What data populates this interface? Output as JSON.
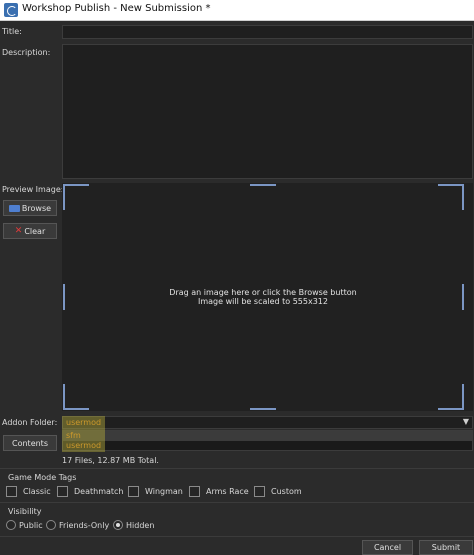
{
  "window": {
    "title": "Workshop Publish - New Submission *"
  },
  "form": {
    "title_label": "Title:",
    "title_value": "",
    "description_label": "Description:",
    "description_value": "",
    "preview_label": "Preview Image:",
    "browse_label": "Browse",
    "clear_label": "Clear",
    "preview_hint_line1": "Drag an image here or click the Browse button",
    "preview_hint_line2": "Image will be scaled to 555x312",
    "addon_label": "Addon Folder:",
    "addon_selected": "usermod",
    "addon_options": [
      "sfm",
      "usermod"
    ],
    "contents_label": "Contents",
    "stats_text": "17 Files, 12.87 MB Total."
  },
  "game_mode": {
    "title": "Game Mode Tags",
    "tags": [
      {
        "label": "Classic",
        "checked": false
      },
      {
        "label": "Deathmatch",
        "checked": false
      },
      {
        "label": "Wingman",
        "checked": false
      },
      {
        "label": "Arms Race",
        "checked": false
      },
      {
        "label": "Custom",
        "checked": false
      }
    ]
  },
  "visibility": {
    "title": "Visibility",
    "options": [
      {
        "label": "Public",
        "selected": false
      },
      {
        "label": "Friends-Only",
        "selected": false
      },
      {
        "label": "Hidden",
        "selected": true
      }
    ]
  },
  "footer": {
    "cancel_label": "Cancel",
    "submit_label": "Submit"
  },
  "colors": {
    "accent": "#7b96c4",
    "addon_text": "#e08a1e",
    "background": "#2b2b2b"
  }
}
